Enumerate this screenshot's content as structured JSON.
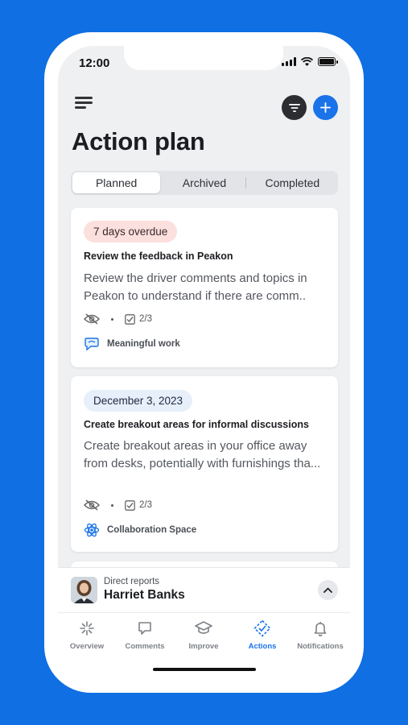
{
  "status_bar": {
    "time": "12:00"
  },
  "header": {
    "menu_icon": "menu-icon",
    "filter_icon": "filter-icon",
    "add_icon": "plus-icon",
    "title": "Action plan"
  },
  "segments": [
    {
      "label": "Planned",
      "active": true
    },
    {
      "label": "Archived",
      "active": false
    },
    {
      "label": "Completed",
      "active": false
    }
  ],
  "cards": [
    {
      "badge": "7 days overdue",
      "badge_type": "overdue",
      "title": "Review the feedback in Peakon",
      "description": "Review the driver comments and topics in Peakon to understand if there are comm..",
      "visibility_icon": "eye-off-icon",
      "progress": "2/3",
      "driver": "Meaningful work",
      "driver_icon": "speech-bubble-icon"
    },
    {
      "badge": "December  3, 2023",
      "badge_type": "date",
      "title": "Create breakout areas for informal discussions",
      "description": "Create breakout areas in your office away from desks, potentially with furnishings tha...",
      "visibility_icon": "eye-off-icon",
      "progress": "2/3",
      "driver": "Collaboration Space",
      "driver_icon": "atom-icon"
    }
  ],
  "drawer": {
    "subtitle": "Direct reports",
    "name": "Harriet Banks",
    "chevron_icon": "chevron-up-icon"
  },
  "tabs": [
    {
      "label": "Overview",
      "icon": "sparkle-icon",
      "active": false
    },
    {
      "label": "Comments",
      "icon": "comment-icon",
      "active": false
    },
    {
      "label": "Improve",
      "icon": "graduation-cap-icon",
      "active": false
    },
    {
      "label": "Actions",
      "icon": "diamond-icon",
      "active": true
    },
    {
      "label": "Notifications",
      "icon": "bell-icon",
      "active": false
    }
  ],
  "colors": {
    "background": "#0f6fe3",
    "accent": "#1a73e8",
    "overdue_bg": "#fbe0de",
    "date_bg": "#e7effa",
    "screen_bg": "#eff0f2"
  }
}
